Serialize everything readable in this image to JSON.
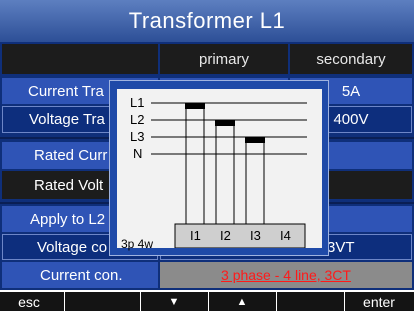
{
  "title": "Transformer L1",
  "columns": {
    "primary": "primary",
    "secondary": "secondary"
  },
  "rows": [
    {
      "label": "Current Tra",
      "primary": "",
      "secondary": "5A"
    },
    {
      "label": "Voltage Tra",
      "primary": "",
      "secondary": "400V"
    },
    {
      "label": "Rated Curr",
      "value": ""
    },
    {
      "label": "Rated Volt",
      "value": ""
    },
    {
      "label": "Apply to L2",
      "value": ""
    },
    {
      "label": "Voltage co",
      "value": "3VT"
    },
    {
      "label": "Current con.",
      "value": "3 phase - 4 line, 3CT"
    }
  ],
  "softkeys": {
    "esc": "esc",
    "down": "▼",
    "up": "▲",
    "enter": "enter"
  },
  "diagram": {
    "lines": [
      "L1",
      "L2",
      "L3",
      "N"
    ],
    "terminals": [
      "I1",
      "I2",
      "I3",
      "I4"
    ],
    "mode": "3p 4w"
  },
  "colors": {
    "background": "#0f2f7a",
    "highlight": "#2f54b6",
    "link_red": "#ff1a1a"
  }
}
